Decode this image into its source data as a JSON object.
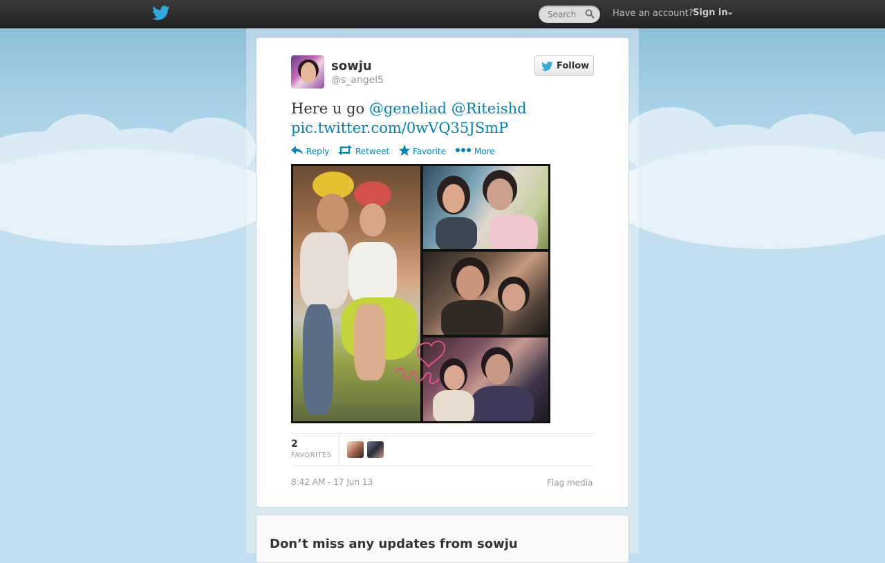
{
  "topbar": {
    "logo_icon": "twitter-bird-icon",
    "search_placeholder": "Search",
    "have_account": "Have an account?",
    "sign_in": "Sign in"
  },
  "tweet": {
    "display_name": "sowju",
    "handle": "@s_angel5",
    "follow_label": "Follow",
    "text_prefix": "Here u go ",
    "mention_1": "@geneliad",
    "mention_2": "@Riteishd",
    "media_link": "pic.twitter.com/0wVQ35JSmP",
    "actions": {
      "reply": "Reply",
      "retweet": "Retweet",
      "favorite": "Favorite",
      "more": "More"
    },
    "stats": {
      "favorites_count": "2",
      "favorites_label": "FAVORITES"
    },
    "timestamp": "8:42 AM - 17 Jun 13",
    "flag_media": "Flag media"
  },
  "promo": {
    "heading": "Don’t miss any updates from sowju"
  },
  "colors": {
    "link": "#0084b4",
    "topbar": "#2b2b2b",
    "background": "#c0deed"
  }
}
